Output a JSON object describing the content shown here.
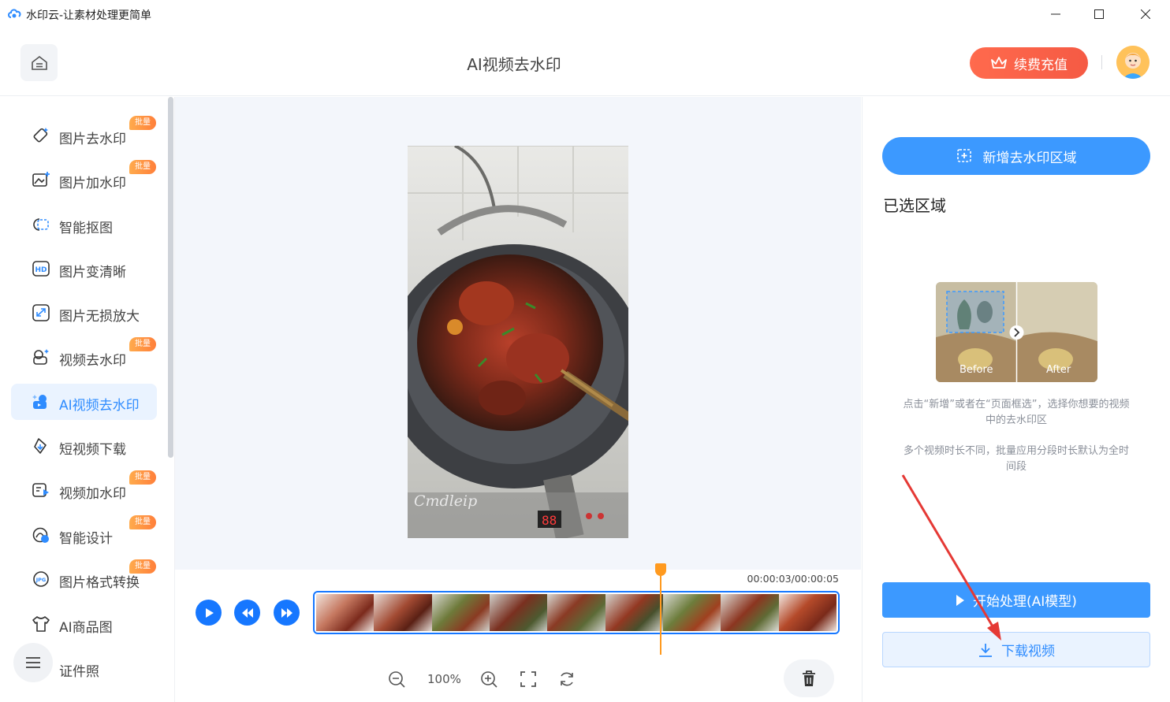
{
  "window": {
    "title": "水印云-让素材处理更简单"
  },
  "header": {
    "title": "AI视频去水印",
    "vip_label": "续费充值"
  },
  "sidebar": {
    "items": [
      {
        "label": "图片去水印",
        "icon": "eraser-icon",
        "badge": "批量"
      },
      {
        "label": "图片加水印",
        "icon": "image-add-icon",
        "badge": "批量"
      },
      {
        "label": "智能抠图",
        "icon": "cutout-icon",
        "badge": ""
      },
      {
        "label": "图片变清晰",
        "icon": "hd-icon",
        "badge": ""
      },
      {
        "label": "图片无损放大",
        "icon": "enlarge-icon",
        "badge": ""
      },
      {
        "label": "视频去水印",
        "icon": "video-eraser-icon",
        "badge": "批量"
      },
      {
        "label": "AI视频去水印",
        "icon": "ai-video-icon",
        "badge": "",
        "active": true
      },
      {
        "label": "短视频下载",
        "icon": "short-video-download-icon",
        "badge": ""
      },
      {
        "label": "视频加水印",
        "icon": "video-add-watermark-icon",
        "badge": "批量"
      },
      {
        "label": "智能设计",
        "icon": "design-icon",
        "badge": "批量"
      },
      {
        "label": "图片格式转换",
        "icon": "format-convert-icon",
        "badge": "批量"
      },
      {
        "label": "AI商品图",
        "icon": "shirt-icon",
        "badge": ""
      },
      {
        "label": "证件照",
        "icon": "id-photo-icon",
        "badge": ""
      }
    ]
  },
  "editor": {
    "watermark_text": "Cmdleip",
    "timecode": "00:00:03/00:00:05",
    "zoom": "100%",
    "frame_count": 9
  },
  "right_panel": {
    "add_area_label": "新增去水印区域",
    "selected_title": "已选区域",
    "before_label": "Before",
    "after_label": "After",
    "hint1": "点击“新增”或者在“页面框选”，选择你想要的视频中的去水印区",
    "hint2": "多个视频时长不同，批量应用分段时长默认为全时间段",
    "start_label": "开始处理(AI模型)",
    "download_label": "下载视频"
  },
  "colors": {
    "accent": "#3c99ff",
    "vip": "#f55a44",
    "badge": "#ff8f3f",
    "playhead": "#ff9a1f",
    "annotation_arrow": "#e53935"
  }
}
